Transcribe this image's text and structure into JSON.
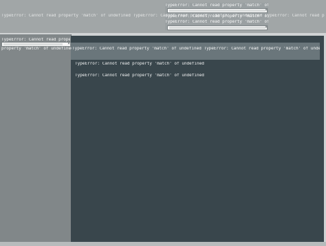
{
  "errors": {
    "line_1": "TypeError: Cannot read property 'match' of undefined TypeError: Cannot read property 'match' of undefined TypeError: Cannot read property 'match' of undefined",
    "line_2": "TypeError: Cannot read property 'match' of",
    "line_3": "TypeError: Cannot read property 'match' of undefined",
    "line_4": "TypeError: Cannot read property 'match' of",
    "line_5": "TypeError: Cannot read prope",
    "line_6": "property 'match' of undefined",
    "line_7": "TypeError: Cannot read property 'match' of undefined TypeError: Cannot read property 'match' of undefined",
    "line_8": "TypeError: Cannot read property 'match' of undefined",
    "line_9": "TypeError: Cannot read property 'match' of undefined"
  },
  "icons": {
    "close": "×"
  }
}
